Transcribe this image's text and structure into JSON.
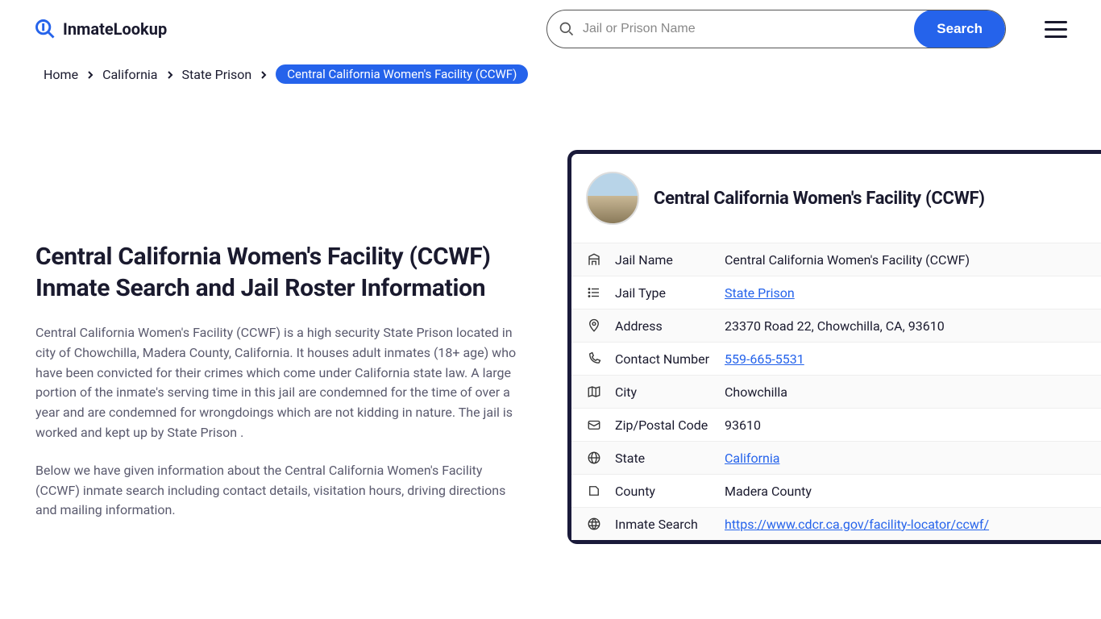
{
  "header": {
    "logo_text": "InmateLookup",
    "search_placeholder": "Jail or Prison Name",
    "search_button": "Search"
  },
  "breadcrumbs": {
    "items": [
      {
        "label": "Home"
      },
      {
        "label": "California"
      },
      {
        "label": "State Prison"
      }
    ],
    "current": "Central California Women's Facility (CCWF)"
  },
  "main": {
    "title": "Central California Women's Facility (CCWF) Inmate Search and Jail Roster Information",
    "p1": "Central California Women's Facility (CCWF) is a high security State Prison located in city of Chowchilla, Madera County, California. It houses adult inmates (18+ age) who have been convicted for their crimes which come under California state law. A large portion of the inmate's serving time in this jail are condemned for the time of over a year and are condemned for wrongdoings which are not kidding in nature. The jail is worked and kept up by State Prison .",
    "p2": "Below we have given information about the Central California Women's Facility (CCWF) inmate search including contact details, visitation hours, driving directions and mailing information."
  },
  "card": {
    "title": "Central California Women's Facility (CCWF)",
    "rows": [
      {
        "icon": "building",
        "label": "Jail Name",
        "value": "Central California Women's Facility (CCWF)",
        "link": false
      },
      {
        "icon": "list",
        "label": "Jail Type",
        "value": "State Prison",
        "link": true
      },
      {
        "icon": "pin",
        "label": "Address",
        "value": "23370 Road 22, Chowchilla, CA, 93610",
        "link": false
      },
      {
        "icon": "phone",
        "label": "Contact Number",
        "value": "559-665-5531",
        "link": true
      },
      {
        "icon": "map",
        "label": "City",
        "value": "Chowchilla",
        "link": false
      },
      {
        "icon": "mail",
        "label": "Zip/Postal Code",
        "value": "93610",
        "link": false
      },
      {
        "icon": "globe",
        "label": "State",
        "value": "California",
        "link": true
      },
      {
        "icon": "shape",
        "label": "County",
        "value": "Madera County",
        "link": false
      },
      {
        "icon": "web",
        "label": "Inmate Search",
        "value": "https://www.cdcr.ca.gov/facility-locator/ccwf/",
        "link": true
      }
    ]
  }
}
